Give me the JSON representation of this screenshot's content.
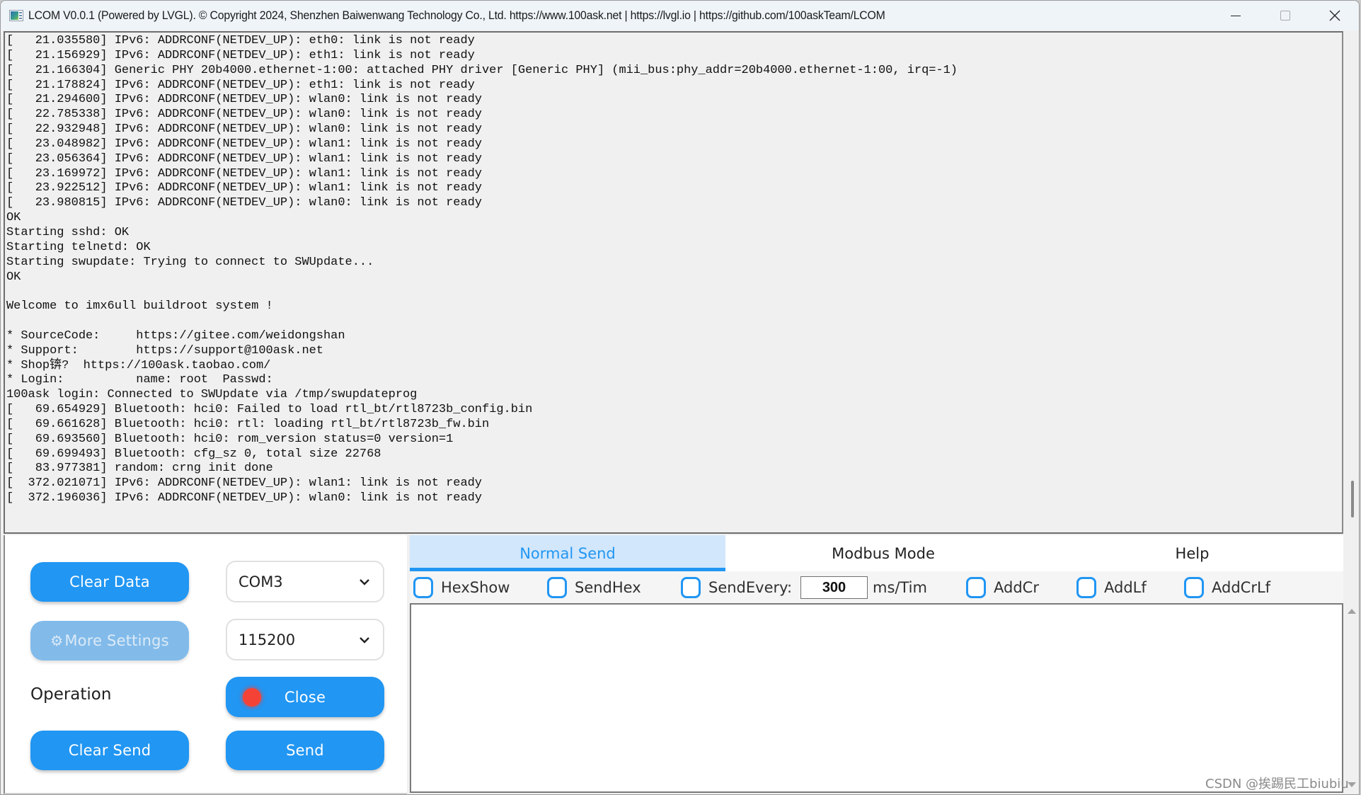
{
  "window": {
    "title": "LCOM V0.0.1 (Powered by LVGL).  © Copyright 2024, Shenzhen Baiwenwang Technology Co., Ltd.   https://www.100ask.net | https://lvgl.io | https://github.com/100askTeam/LCOM",
    "icon": "app-icon",
    "controls": {
      "minimize": "minimize-icon",
      "maximize": "maximize-icon",
      "close": "close-icon"
    }
  },
  "log": {
    "lines": [
      "[   21.035580] IPv6: ADDRCONF(NETDEV_UP): eth0: link is not ready",
      "[   21.156929] IPv6: ADDRCONF(NETDEV_UP): eth1: link is not ready",
      "[   21.166304] Generic PHY 20b4000.ethernet-1:00: attached PHY driver [Generic PHY] (mii_bus:phy_addr=20b4000.ethernet-1:00, irq=-1)",
      "[   21.178824] IPv6: ADDRCONF(NETDEV_UP): eth1: link is not ready",
      "[   21.294600] IPv6: ADDRCONF(NETDEV_UP): wlan0: link is not ready",
      "[   22.785338] IPv6: ADDRCONF(NETDEV_UP): wlan0: link is not ready",
      "[   22.932948] IPv6: ADDRCONF(NETDEV_UP): wlan0: link is not ready",
      "[   23.048982] IPv6: ADDRCONF(NETDEV_UP): wlan1: link is not ready",
      "[   23.056364] IPv6: ADDRCONF(NETDEV_UP): wlan1: link is not ready",
      "[   23.169972] IPv6: ADDRCONF(NETDEV_UP): wlan1: link is not ready",
      "[   23.922512] IPv6: ADDRCONF(NETDEV_UP): wlan1: link is not ready",
      "[   23.980815] IPv6: ADDRCONF(NETDEV_UP): wlan0: link is not ready",
      "OK",
      "Starting sshd: OK",
      "Starting telnetd: OK",
      "Starting swupdate: Trying to connect to SWUpdate...",
      "OK",
      "",
      "Welcome to imx6ull buildroot system !",
      "",
      "* SourceCode:     https://gitee.com/weidongshan",
      "* Support:        https://support@100ask.net",
      "* Shop锛?  https://100ask.taobao.com/",
      "* Login:          name: root  Passwd:",
      "100ask login: Connected to SWUpdate via /tmp/swupdateprog",
      "[   69.654929] Bluetooth: hci0: Failed to load rtl_bt/rtl8723b_config.bin",
      "[   69.661628] Bluetooth: hci0: rtl: loading rtl_bt/rtl8723b_fw.bin",
      "[   69.693560] Bluetooth: hci0: rom_version status=0 version=1",
      "[   69.699493] Bluetooth: cfg_sz 0, total size 22768",
      "[   83.977381] random: crng init done",
      "[  372.021071] IPv6: ADDRCONF(NETDEV_UP): wlan1: link is not ready",
      "[  372.196036] IPv6: ADDRCONF(NETDEV_UP): wlan0: link is not ready"
    ],
    "scroll_position": 0.95
  },
  "controls": {
    "clear_data": "Clear Data",
    "more_settings": "More Settings",
    "more_settings_icon": "gear-icon",
    "operation_label": "Operation",
    "clear_send": "Clear Send",
    "port": {
      "selected": "COM3",
      "icon": "chevron-down-icon"
    },
    "baud": {
      "selected": "115200",
      "icon": "chevron-down-icon"
    },
    "close": {
      "label": "Close",
      "status_color": "#f44336"
    },
    "send": "Send"
  },
  "tabs": [
    {
      "label": "Normal Send",
      "active": true
    },
    {
      "label": "Modbus Mode",
      "active": false
    },
    {
      "label": "Help",
      "active": false
    }
  ],
  "options": {
    "hexshow": {
      "label": "HexShow",
      "checked": false
    },
    "sendhex": {
      "label": "SendHex",
      "checked": false
    },
    "sendevery": {
      "label": "SendEvery:",
      "checked": false,
      "value": "300",
      "unit": "ms/Tim"
    },
    "addcr": {
      "label": "AddCr",
      "checked": false
    },
    "addlf": {
      "label": "AddLf",
      "checked": false
    },
    "addcrlf": {
      "label": "AddCrLf",
      "checked": false
    }
  },
  "send_box": {
    "value": ""
  },
  "watermark": "CSDN @挨踢民工biubiu",
  "colors": {
    "accent": "#2196f3",
    "accent_disabled": "#82bbea",
    "tab_active_bg": "#d2e7fb",
    "status_red": "#f44336"
  }
}
